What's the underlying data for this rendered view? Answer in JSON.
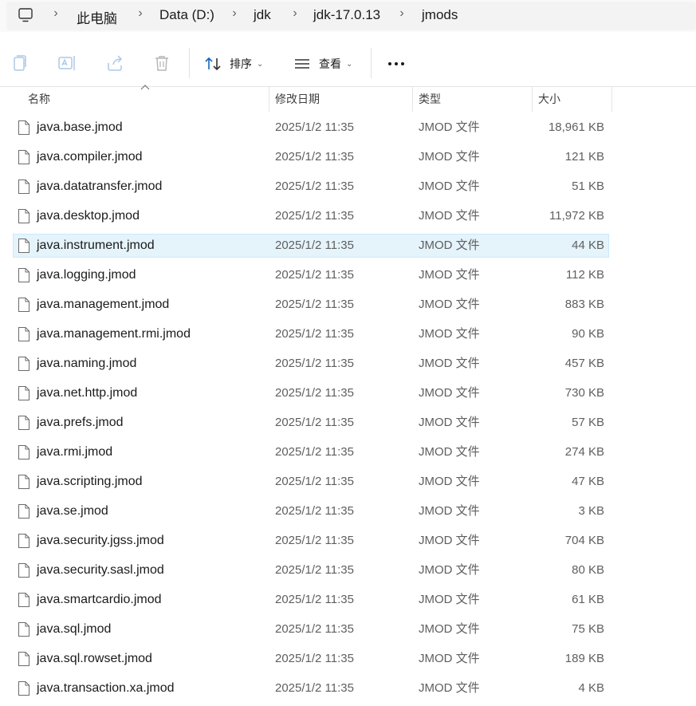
{
  "breadcrumb": {
    "items": [
      "此电脑",
      "Data (D:)",
      "jdk",
      "jdk-17.0.13",
      "jmods"
    ],
    "separator": "›"
  },
  "toolbar": {
    "sort_label": "排序",
    "view_label": "查看",
    "more_label": "•••"
  },
  "columns": {
    "name": "名称",
    "date": "修改日期",
    "type": "类型",
    "size": "大小"
  },
  "files": [
    {
      "name": "java.base.jmod",
      "date": "2025/1/2 11:35",
      "type": "JMOD 文件",
      "size": "18,961 KB"
    },
    {
      "name": "java.compiler.jmod",
      "date": "2025/1/2 11:35",
      "type": "JMOD 文件",
      "size": "121 KB"
    },
    {
      "name": "java.datatransfer.jmod",
      "date": "2025/1/2 11:35",
      "type": "JMOD 文件",
      "size": "51 KB"
    },
    {
      "name": "java.desktop.jmod",
      "date": "2025/1/2 11:35",
      "type": "JMOD 文件",
      "size": "11,972 KB"
    },
    {
      "name": "java.instrument.jmod",
      "date": "2025/1/2 11:35",
      "type": "JMOD 文件",
      "size": "44 KB",
      "selected": true
    },
    {
      "name": "java.logging.jmod",
      "date": "2025/1/2 11:35",
      "type": "JMOD 文件",
      "size": "112 KB"
    },
    {
      "name": "java.management.jmod",
      "date": "2025/1/2 11:35",
      "type": "JMOD 文件",
      "size": "883 KB"
    },
    {
      "name": "java.management.rmi.jmod",
      "date": "2025/1/2 11:35",
      "type": "JMOD 文件",
      "size": "90 KB"
    },
    {
      "name": "java.naming.jmod",
      "date": "2025/1/2 11:35",
      "type": "JMOD 文件",
      "size": "457 KB"
    },
    {
      "name": "java.net.http.jmod",
      "date": "2025/1/2 11:35",
      "type": "JMOD 文件",
      "size": "730 KB"
    },
    {
      "name": "java.prefs.jmod",
      "date": "2025/1/2 11:35",
      "type": "JMOD 文件",
      "size": "57 KB"
    },
    {
      "name": "java.rmi.jmod",
      "date": "2025/1/2 11:35",
      "type": "JMOD 文件",
      "size": "274 KB"
    },
    {
      "name": "java.scripting.jmod",
      "date": "2025/1/2 11:35",
      "type": "JMOD 文件",
      "size": "47 KB"
    },
    {
      "name": "java.se.jmod",
      "date": "2025/1/2 11:35",
      "type": "JMOD 文件",
      "size": "3 KB"
    },
    {
      "name": "java.security.jgss.jmod",
      "date": "2025/1/2 11:35",
      "type": "JMOD 文件",
      "size": "704 KB"
    },
    {
      "name": "java.security.sasl.jmod",
      "date": "2025/1/2 11:35",
      "type": "JMOD 文件",
      "size": "80 KB"
    },
    {
      "name": "java.smartcardio.jmod",
      "date": "2025/1/2 11:35",
      "type": "JMOD 文件",
      "size": "61 KB"
    },
    {
      "name": "java.sql.jmod",
      "date": "2025/1/2 11:35",
      "type": "JMOD 文件",
      "size": "75 KB"
    },
    {
      "name": "java.sql.rowset.jmod",
      "date": "2025/1/2 11:35",
      "type": "JMOD 文件",
      "size": "189 KB"
    },
    {
      "name": "java.transaction.xa.jmod",
      "date": "2025/1/2 11:35",
      "type": "JMOD 文件",
      "size": "4 KB"
    }
  ],
  "icons": {
    "pc": "computer-icon",
    "copy": "copy-icon",
    "rename": "rename-icon",
    "share": "share-icon",
    "delete": "trash-icon",
    "sort": "sort-icon",
    "view": "view-icon",
    "file": "file-icon"
  },
  "colors": {
    "selection_bg": "#e5f3fb",
    "selection_border": "#cce8ff"
  }
}
